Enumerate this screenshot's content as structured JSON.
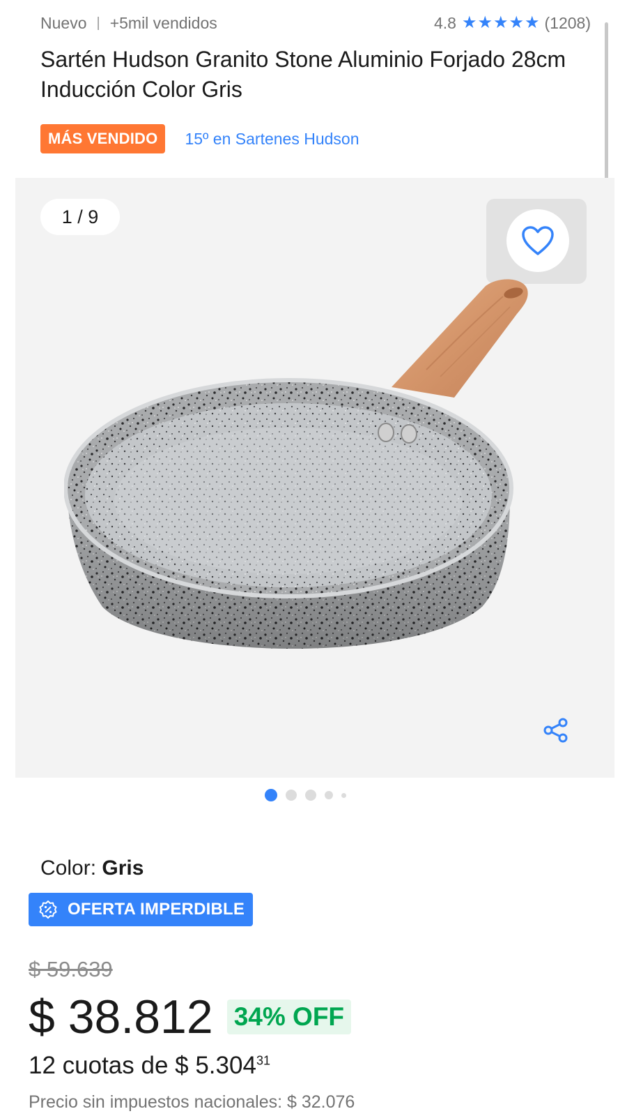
{
  "header": {
    "condition": "Nuevo",
    "separator": "|",
    "sold": "+5mil vendidos",
    "rating": "4.8",
    "stars": 5,
    "reviews": "(1208)"
  },
  "product": {
    "title": "Sartén Hudson Granito Stone Aluminio Forjado 28cm Inducción Color Gris",
    "badge": "MÁS VENDIDO",
    "rank": "15º en Sartenes Hudson"
  },
  "gallery": {
    "counter": "1 / 9",
    "icons": {
      "favorite": "heart-icon",
      "share": "share-icon"
    },
    "dots_total": 5,
    "dot_active_index": 0
  },
  "details": {
    "color_label": "Color: ",
    "color_value": "Gris",
    "deal_label": "OFERTA IMPERDIBLE",
    "old_price": "$ 59.639",
    "price": "$ 38.812",
    "discount": "34% OFF",
    "installments_text": "12 cuotas de $ 5.304",
    "installments_cents": "31",
    "tax_note": "Precio sin impuestos nacionales: $ 32.076"
  },
  "colors": {
    "accent": "#3483fa",
    "best_seller": "#ff7733",
    "discount": "#00a650"
  }
}
